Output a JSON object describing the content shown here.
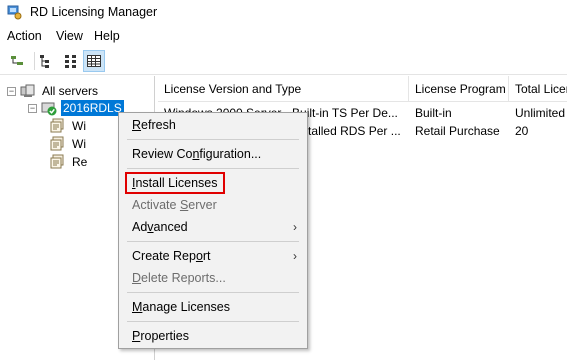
{
  "window": {
    "title": "RD Licensing Manager"
  },
  "menubar": {
    "items": [
      "Action",
      "View",
      "Help"
    ]
  },
  "tree": {
    "root": {
      "label": "All servers"
    },
    "server": {
      "label": "2016RDLS"
    },
    "children": [
      "Wi",
      "Wi",
      "Re"
    ]
  },
  "list": {
    "columns": [
      "License Version and Type",
      "License Program",
      "Total Licen"
    ],
    "rows": [
      {
        "version": "Windows 2000 Server - Built-in TS Per De...",
        "program": "Built-in",
        "total": "Unlimited"
      },
      {
        "version": "Windows Server 2016 - Installed RDS Per ...",
        "program": "Retail Purchase",
        "total": "20"
      }
    ]
  },
  "context_menu": {
    "items": [
      {
        "pre": "",
        "key": "R",
        "post": "efresh",
        "disabled": false,
        "submenu": false
      },
      {
        "pre": "Review Co",
        "key": "n",
        "post": "figuration...",
        "disabled": false,
        "submenu": false
      },
      {
        "pre": "",
        "key": "I",
        "post": "nstall Licenses",
        "disabled": false,
        "submenu": false,
        "highlighted": true
      },
      {
        "pre": "Activate ",
        "key": "S",
        "post": "erver",
        "disabled": true,
        "submenu": false
      },
      {
        "pre": "Ad",
        "key": "v",
        "post": "anced",
        "disabled": false,
        "submenu": true
      },
      {
        "pre": "Create Rep",
        "key": "o",
        "post": "rt",
        "disabled": false,
        "submenu": true
      },
      {
        "pre": "",
        "key": "D",
        "post": "elete Reports...",
        "disabled": true,
        "submenu": false
      },
      {
        "pre": "",
        "key": "M",
        "post": "anage Licenses",
        "disabled": false,
        "submenu": false
      },
      {
        "pre": "",
        "key": "P",
        "post": "roperties",
        "disabled": false,
        "submenu": false
      }
    ]
  },
  "colors": {
    "selection": "#0078d7",
    "highlight_border": "#e00000",
    "menu_bg": "#f2f2f2"
  },
  "icons": [
    "app-icon",
    "up-level-icon",
    "show-hide-tree-icon",
    "list-view-icon",
    "details-view-icon",
    "server-group-icon",
    "server-check-icon",
    "license-node-icon"
  ]
}
